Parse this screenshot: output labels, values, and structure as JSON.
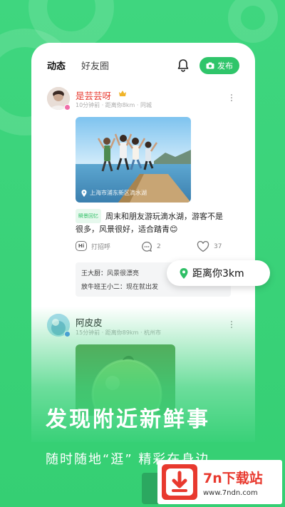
{
  "header": {
    "tab_active": "动态",
    "tab_friends": "好友圈",
    "publish_label": "发布"
  },
  "post1": {
    "username": "是芸芸呀",
    "meta": "10分钟前  ·  距离你8km  ·  同城",
    "tag": "瞬景回忆",
    "text": "周末和朋友游玩滴水湖，游客不是很多，风景很好，适合踏青😊",
    "photo_location": "上海市浦东新区滴水湖",
    "actions": {
      "greet": "打招呼",
      "comment_count": "2",
      "like_count": "37"
    },
    "comments": [
      {
        "author": "王大厨：",
        "content": "风景很漂亮"
      },
      {
        "author": "放牛班王小二：",
        "content": "现在就出发"
      }
    ]
  },
  "post2": {
    "username": "阿皮皮",
    "meta": "15分钟前  ·  距离你89km  ·  杭州市"
  },
  "distance_badge": "距离你3km",
  "promo": {
    "headline": "发现附近新鲜事",
    "subline": "随时随地“逛”  精彩在身边"
  },
  "watermark": {
    "title": "7n下载站",
    "url": "www.7ndn.com"
  },
  "colors": {
    "brand_green": "#3ad27a",
    "publish_green": "#2fc56a",
    "username_red": "#e8392e"
  }
}
